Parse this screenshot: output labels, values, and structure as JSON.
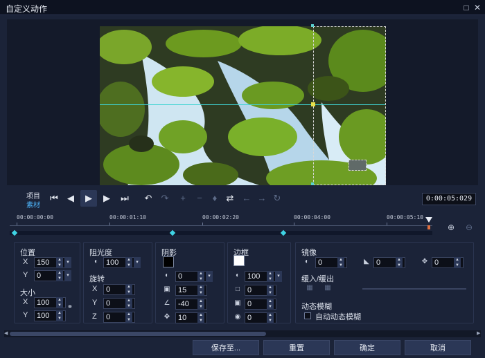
{
  "window": {
    "title": "自定义动作",
    "maximize_glyph": "□",
    "close_glyph": "✕"
  },
  "playback": {
    "mode_project": "项目",
    "mode_clip": "素材",
    "timecode": "0:00:05:029",
    "button_glyphs": [
      "⏮",
      "◀",
      "▶",
      "▶",
      "⏭"
    ]
  },
  "toolbar_glyphs": [
    "↶",
    "↷",
    "+",
    "−",
    "♦",
    "⇄",
    "←",
    "→",
    "↻"
  ],
  "timeline": {
    "ruler": [
      "00:00:00:00",
      "00:00:01:10",
      "00:00:02:20",
      "00:00:04:00",
      "00:00:05:10"
    ]
  },
  "position": {
    "label": "位置",
    "x_label": "X",
    "x_value": "150",
    "y_label": "Y",
    "y_value": "0"
  },
  "size": {
    "label": "大小",
    "x_label": "X",
    "x_value": "100",
    "y_label": "Y",
    "y_value": "100"
  },
  "opacity": {
    "label": "阻光度",
    "value": "100"
  },
  "rotation": {
    "label": "旋转",
    "x_label": "X",
    "x_value": "0",
    "y_label": "Y",
    "y_value": "0",
    "z_label": "Z",
    "z_value": "0"
  },
  "shadow": {
    "label": "阴影",
    "color": "#000000",
    "opacity": "0",
    "blur": "15",
    "angle": "-40",
    "distance": "10"
  },
  "border": {
    "label": "边框",
    "color": "#ffffff",
    "opacity": "100",
    "width": "0",
    "v2": "0",
    "v3": "0"
  },
  "mirror": {
    "label": "镜像",
    "v1": "0",
    "v2": "0",
    "v3": "0"
  },
  "ease": {
    "label": "缓入/缓出"
  },
  "motion_blur": {
    "label": "动态模糊",
    "auto_label": "自动动态模糊"
  },
  "footer": {
    "save_label": "保存至...",
    "reset_label": "重置",
    "ok_label": "确定",
    "cancel_label": "取消"
  },
  "colors": {
    "accent_cyan": "#3fd3e4",
    "playhead_orange": "#e07040",
    "handle_yellow": "#e8e04a"
  }
}
